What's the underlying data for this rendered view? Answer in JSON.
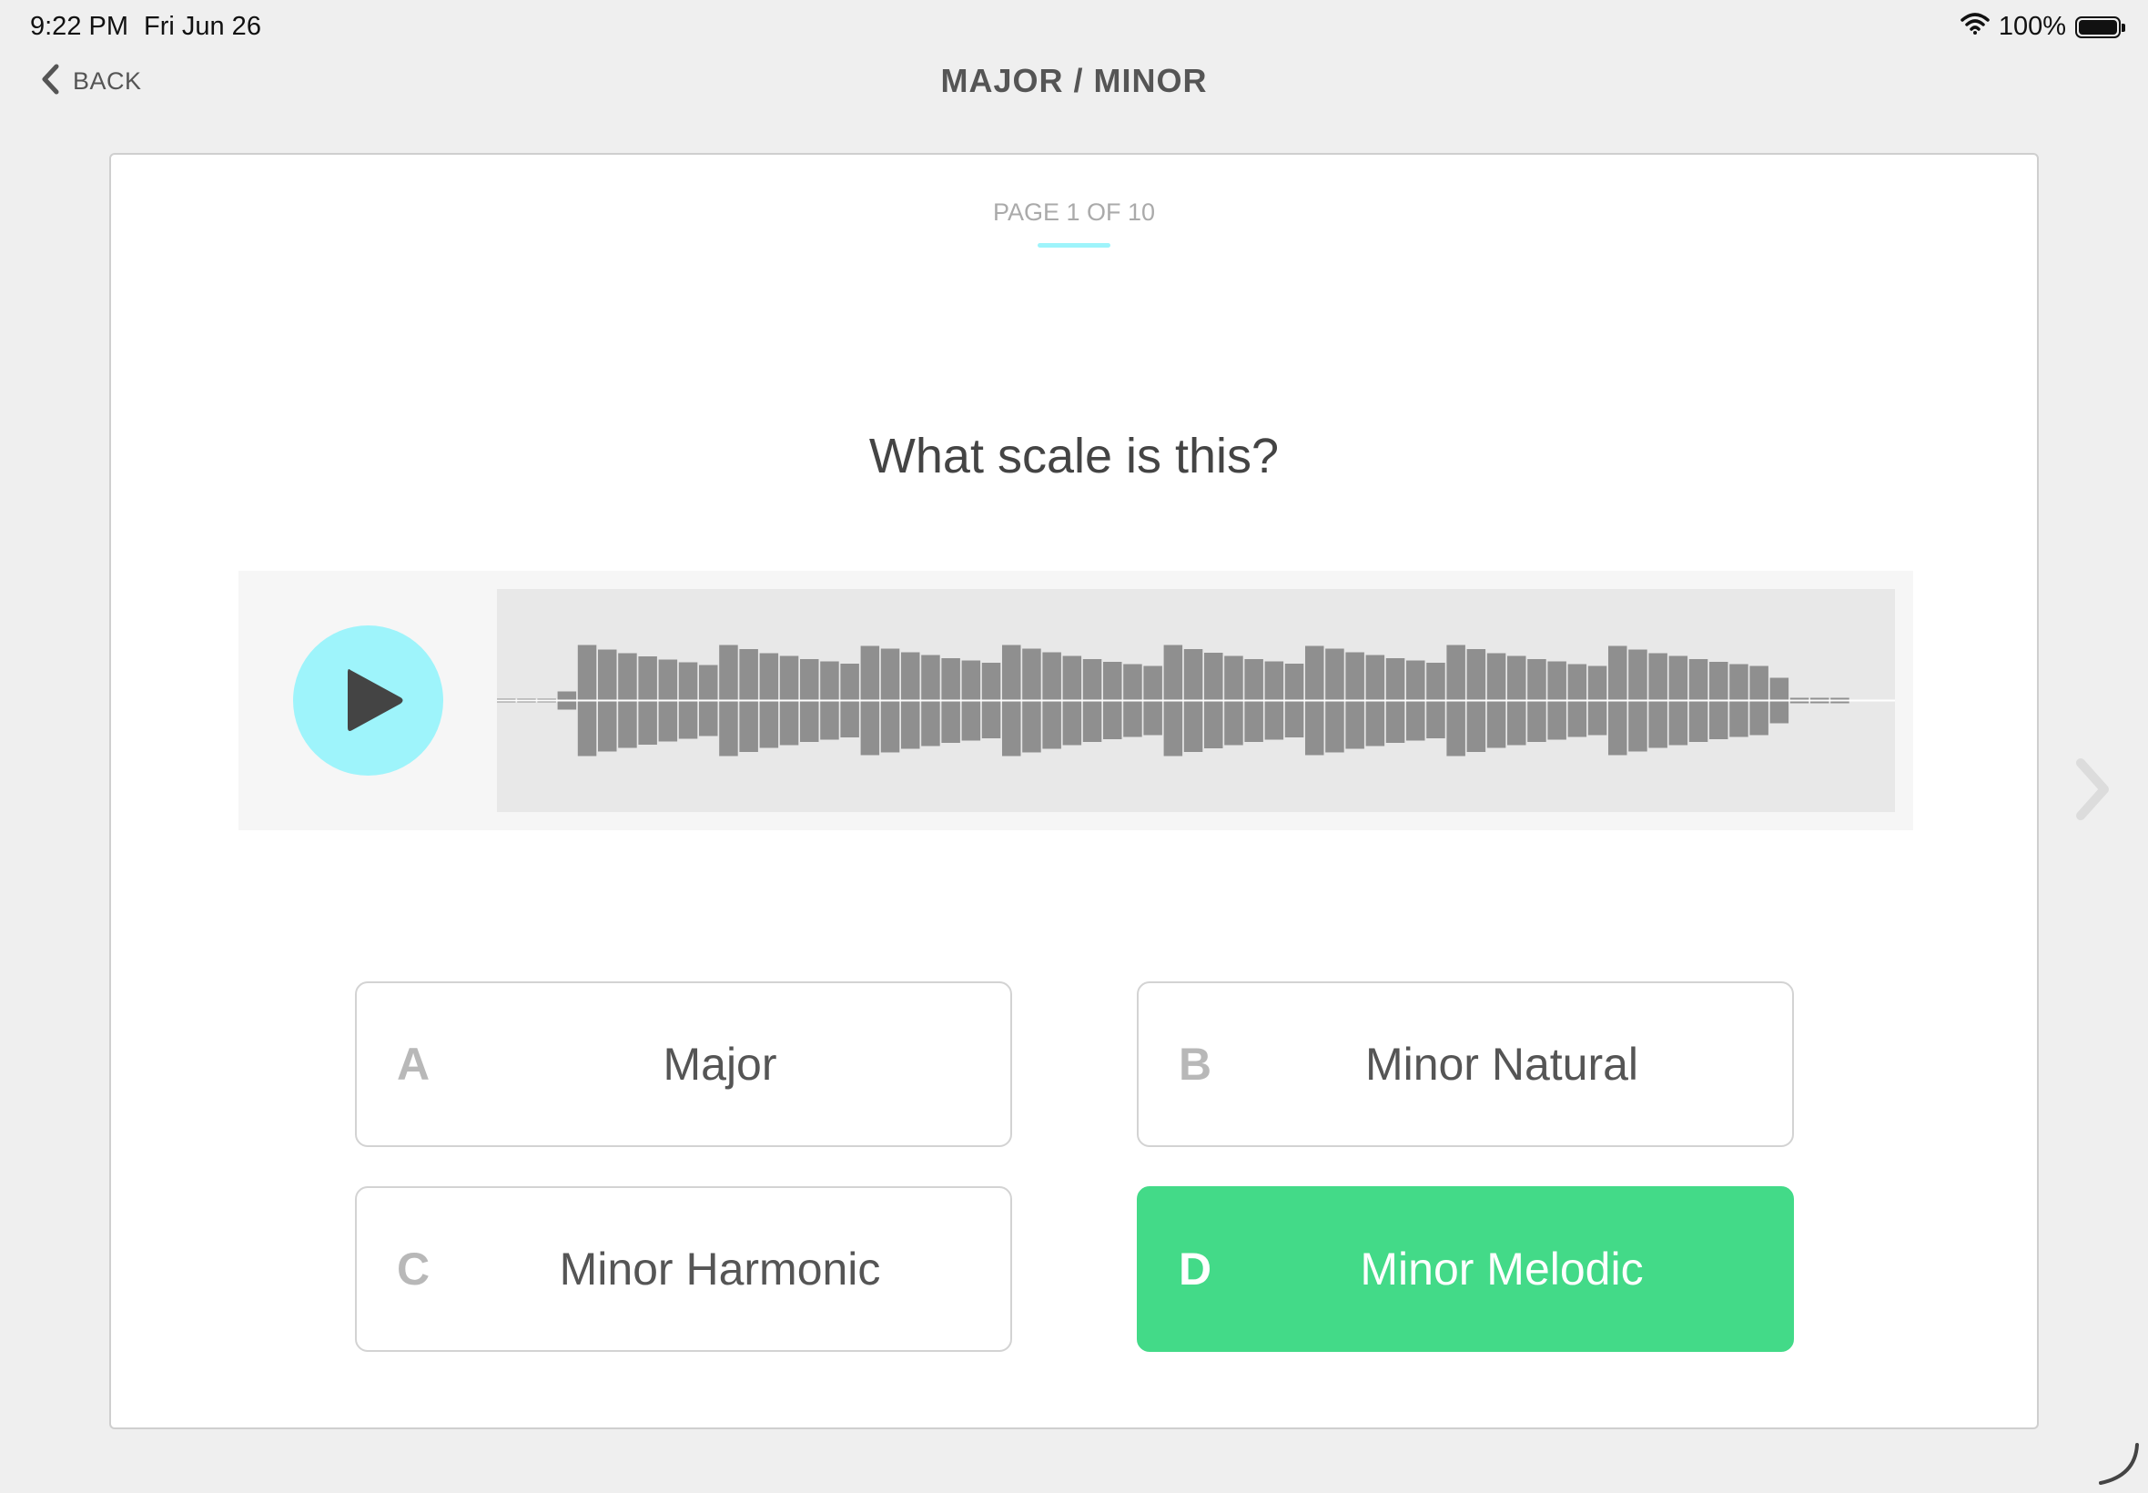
{
  "status_bar": {
    "time": "9:22 PM",
    "date": "Fri Jun 26",
    "battery_label": "100%"
  },
  "nav": {
    "back_label": "BACK",
    "title": "MAJOR / MINOR"
  },
  "quiz": {
    "page_indicator": "PAGE 1 OF 10",
    "question": "What scale is this?",
    "answers": [
      {
        "letter": "A",
        "label": "Major",
        "selected": false
      },
      {
        "letter": "B",
        "label": "Minor Natural",
        "selected": false
      },
      {
        "letter": "C",
        "label": "Minor Harmonic",
        "selected": false
      },
      {
        "letter": "D",
        "label": "Minor Melodic",
        "selected": true
      }
    ]
  },
  "colors": {
    "accent": "#9ef4fb",
    "selected": "#43da88",
    "waveform": "#8f8f8f",
    "waveform_bg": "#e8e8e8"
  },
  "icons": {
    "back": "chevron-left-icon",
    "play": "play-icon",
    "next": "chevron-right-icon",
    "wifi": "wifi-icon",
    "battery": "battery-icon"
  }
}
